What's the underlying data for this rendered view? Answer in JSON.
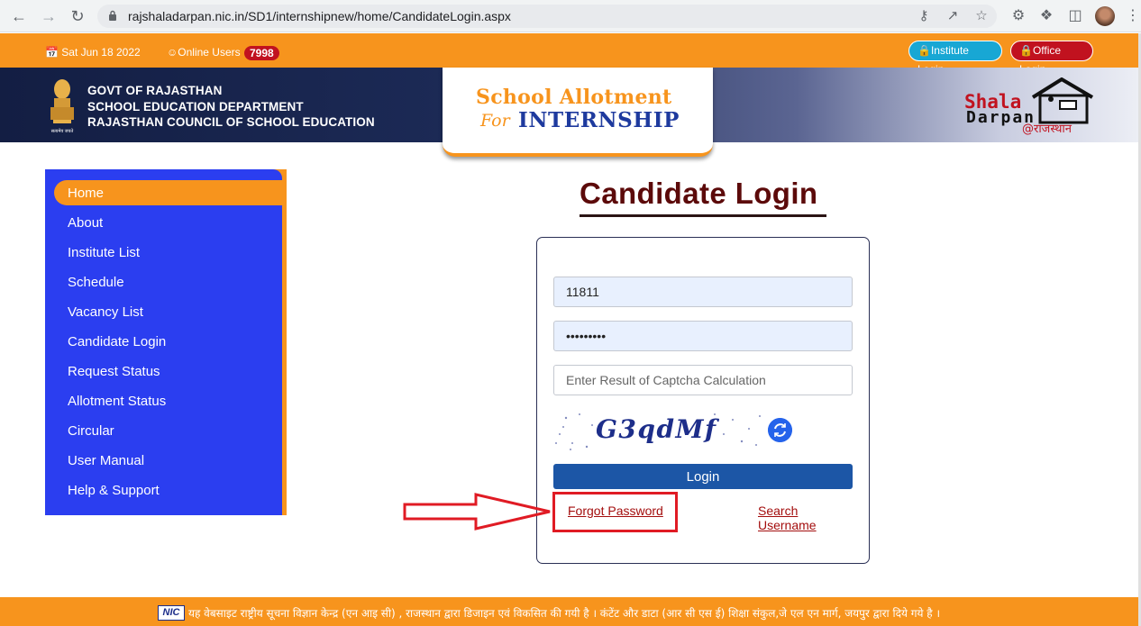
{
  "browser": {
    "url": "rajshaladarpan.nic.in/SD1/internshipnew/home/CandidateLogin.aspx"
  },
  "topbar": {
    "date": "Sat Jun 18 2022",
    "online_label": "Online Users",
    "online_count": "7998",
    "institute_login": "Institute Login",
    "office_login": "Office Login"
  },
  "header": {
    "govt_line1": "GOVT OF RAJASTHAN",
    "govt_line2": "SCHOOL EDUCATION DEPARTMENT",
    "govt_line3": "RAJASTHAN COUNCIL OF SCHOOL EDUCATION",
    "emblem_motto": "सत्यमेव जयते",
    "title_line1": "School Allotment",
    "title_for": "For",
    "title_line2": "INTERNSHIP",
    "logo_shala": "Shala",
    "logo_darpan": "Darpan",
    "logo_tag": "@राजस्थान"
  },
  "sidebar": {
    "items": [
      {
        "label": "Home",
        "active": true
      },
      {
        "label": "About"
      },
      {
        "label": "Institute List"
      },
      {
        "label": "Schedule"
      },
      {
        "label": "Vacancy List"
      },
      {
        "label": "Candidate Login"
      },
      {
        "label": "Request Status"
      },
      {
        "label": "Allotment Status"
      },
      {
        "label": "Circular"
      },
      {
        "label": "User Manual"
      },
      {
        "label": "Help & Support"
      }
    ]
  },
  "login": {
    "title": "Candidate Login",
    "username_value": "11811",
    "password_value": "•••••••••",
    "captcha_placeholder": "Enter Result of Captcha Calculation",
    "captcha_text": "G3qdMf",
    "login_button": "Login",
    "forgot_password": "Forgot Password",
    "search_username_line1": "Search",
    "search_username_line2": "Username"
  },
  "footer": {
    "nic": "NIC",
    "text": "यह वेबसाइट राष्ट्रीय सूचना विज्ञान केन्द्र (एन आइ सी) , राजस्थान द्वारा डिजाइन एवं विकसित की गयी है । कंटेंट और डाटा (आर सी एस ई) शिक्षा संकुल,जे एल एन मार्ग, जयपुर द्वारा दिये गये है ।"
  },
  "colors": {
    "orange": "#f7941d",
    "sidebar_blue": "#2b3ef0",
    "login_btn": "#1c56a6",
    "title_maroon": "#5c0a0a",
    "highlight_red": "#e01b24"
  }
}
